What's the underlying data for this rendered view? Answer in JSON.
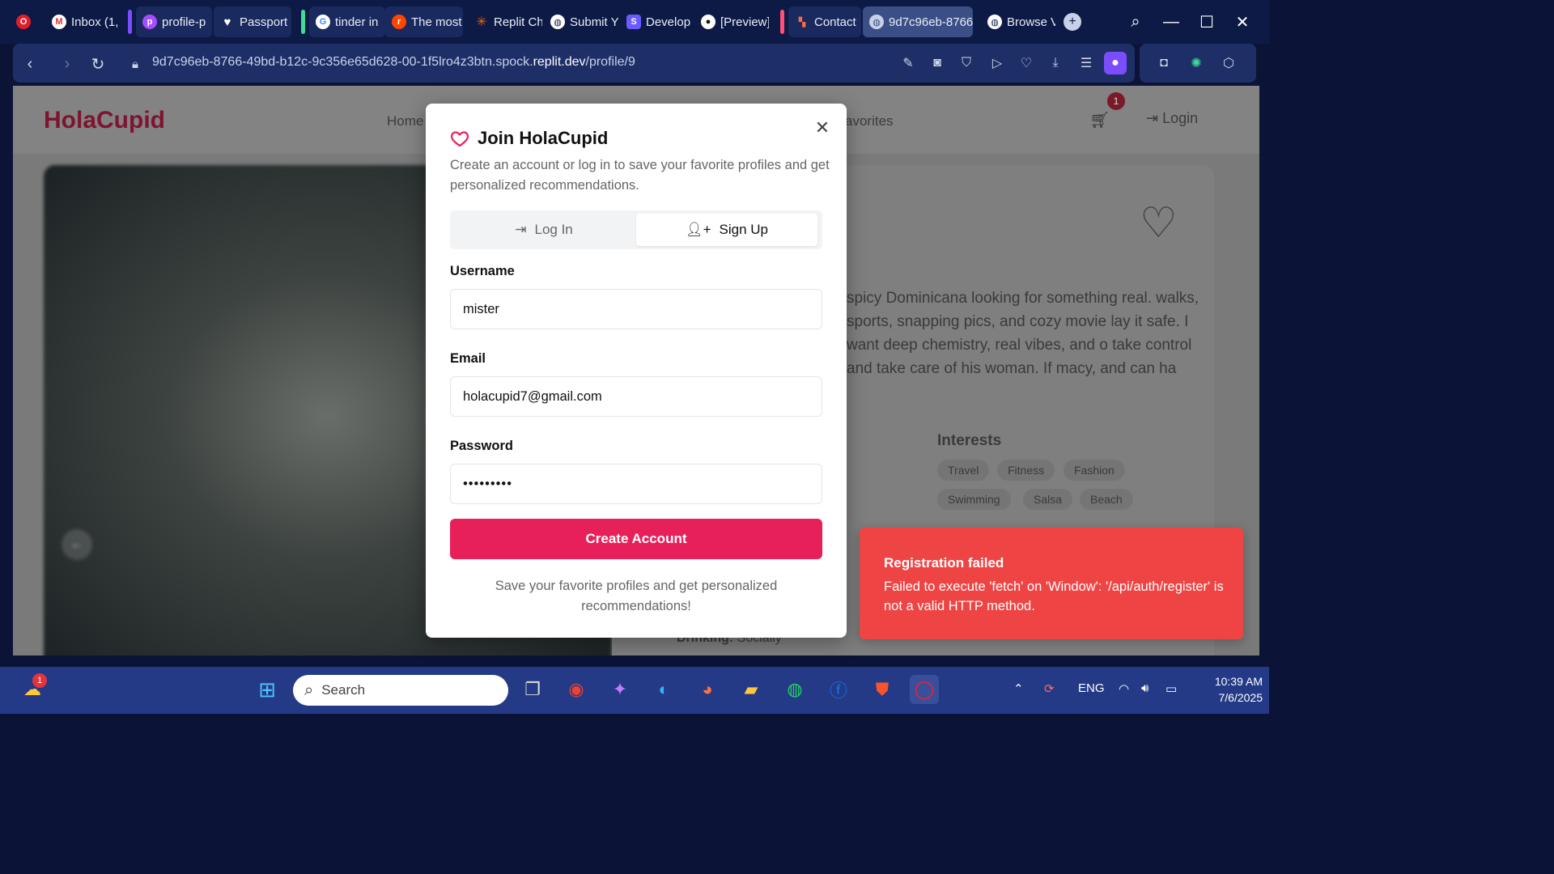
{
  "browser": {
    "tabs": [
      {
        "label": "Inbox (1,",
        "icon": "gmail-icon"
      },
      {
        "label": "profile-p",
        "icon": "app-icon"
      },
      {
        "label": "Passport",
        "icon": "heart-icon"
      },
      {
        "label": "tinder in",
        "icon": "google-icon"
      },
      {
        "label": "The most",
        "icon": "reddit-icon"
      },
      {
        "label": "Replit Ch",
        "icon": "replit-icon"
      },
      {
        "label": "Submit Y",
        "icon": "globe-icon"
      },
      {
        "label": "Develop",
        "icon": "s-icon"
      },
      {
        "label": "[Preview]",
        "icon": "github-icon"
      },
      {
        "label": "Contact",
        "icon": "contact-icon"
      },
      {
        "label": "9d7c96eb-8766",
        "icon": "globe-icon"
      },
      {
        "label": "Browse V",
        "icon": "globe-icon"
      }
    ],
    "url_prefix": "9d7c96eb-8766-49bd-b12c-9c356e65d628-00-1f5lro4z3btn.spock.",
    "url_domain": "replit.dev",
    "url_path": "/profile/9"
  },
  "site": {
    "logo": "HolaCupid",
    "nav_home": "Home",
    "nav_favorites": "avorites",
    "cart_count": "1",
    "login": "Login",
    "bio": "spicy Dominicana looking for something real. walks, sports, snapping pics, and cozy movie lay it safe. I want deep chemistry, real vibes, and o take control and take care of his woman. If macy, and can ha",
    "interests_title": "Interests",
    "interests": [
      "Travel",
      "Fitness",
      "Fashion",
      "Swimming",
      "Salsa",
      "Beach"
    ],
    "drinking_label": "Drinking:",
    "drinking_value": "Socially"
  },
  "modal": {
    "title": "Join HolaCupid",
    "description": "Create an account or log in to save your favorite profiles and get personalized recommendations.",
    "tab_login": "Log In",
    "tab_signup": "Sign Up",
    "username_label": "Username",
    "username_value": "mister",
    "email_label": "Email",
    "email_value": "holacupid7@gmail.com",
    "password_label": "Password",
    "password_value": "•••••••••",
    "submit": "Create Account",
    "footer": "Save your favorite profiles and get personalized recommendations!"
  },
  "toast": {
    "title": "Registration failed",
    "message": "Failed to execute 'fetch' on 'Window': '/api/auth/register' is not a valid HTTP method."
  },
  "taskbar": {
    "search_placeholder": "Search",
    "weather_badge": "1",
    "language": "ENG",
    "time": "10:39 AM",
    "date": "7/6/2025"
  },
  "colors": {
    "accent": "#e8205a",
    "toast": "#ef4444",
    "logo": "#7d1430",
    "browser_bg": "#0d1a45"
  }
}
